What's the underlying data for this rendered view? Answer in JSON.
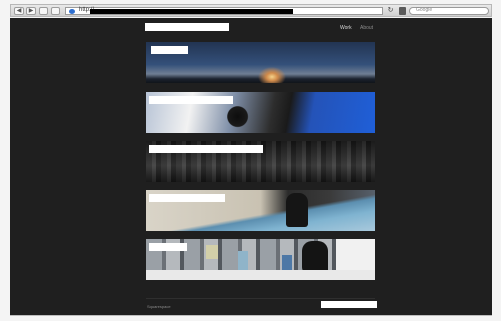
{
  "browser": {
    "back_glyph": "◀",
    "forward_glyph": "▶",
    "reload_glyph": "↻",
    "url_prefix": "http://",
    "search_placeholder": "Google",
    "icons": [
      "back-arrow-icon",
      "forward-arrow-icon",
      "globe-icon",
      "refresh-icon",
      "search-engine-icon"
    ]
  },
  "site": {
    "nav": [
      {
        "label": "Work"
      },
      {
        "label": "About"
      }
    ]
  },
  "footer": {
    "credit": "Squarespace"
  },
  "colors": {
    "page_background": "#1f1f1f",
    "nav_active": "#d8d8d8",
    "nav_inactive": "#8c8c8c"
  }
}
